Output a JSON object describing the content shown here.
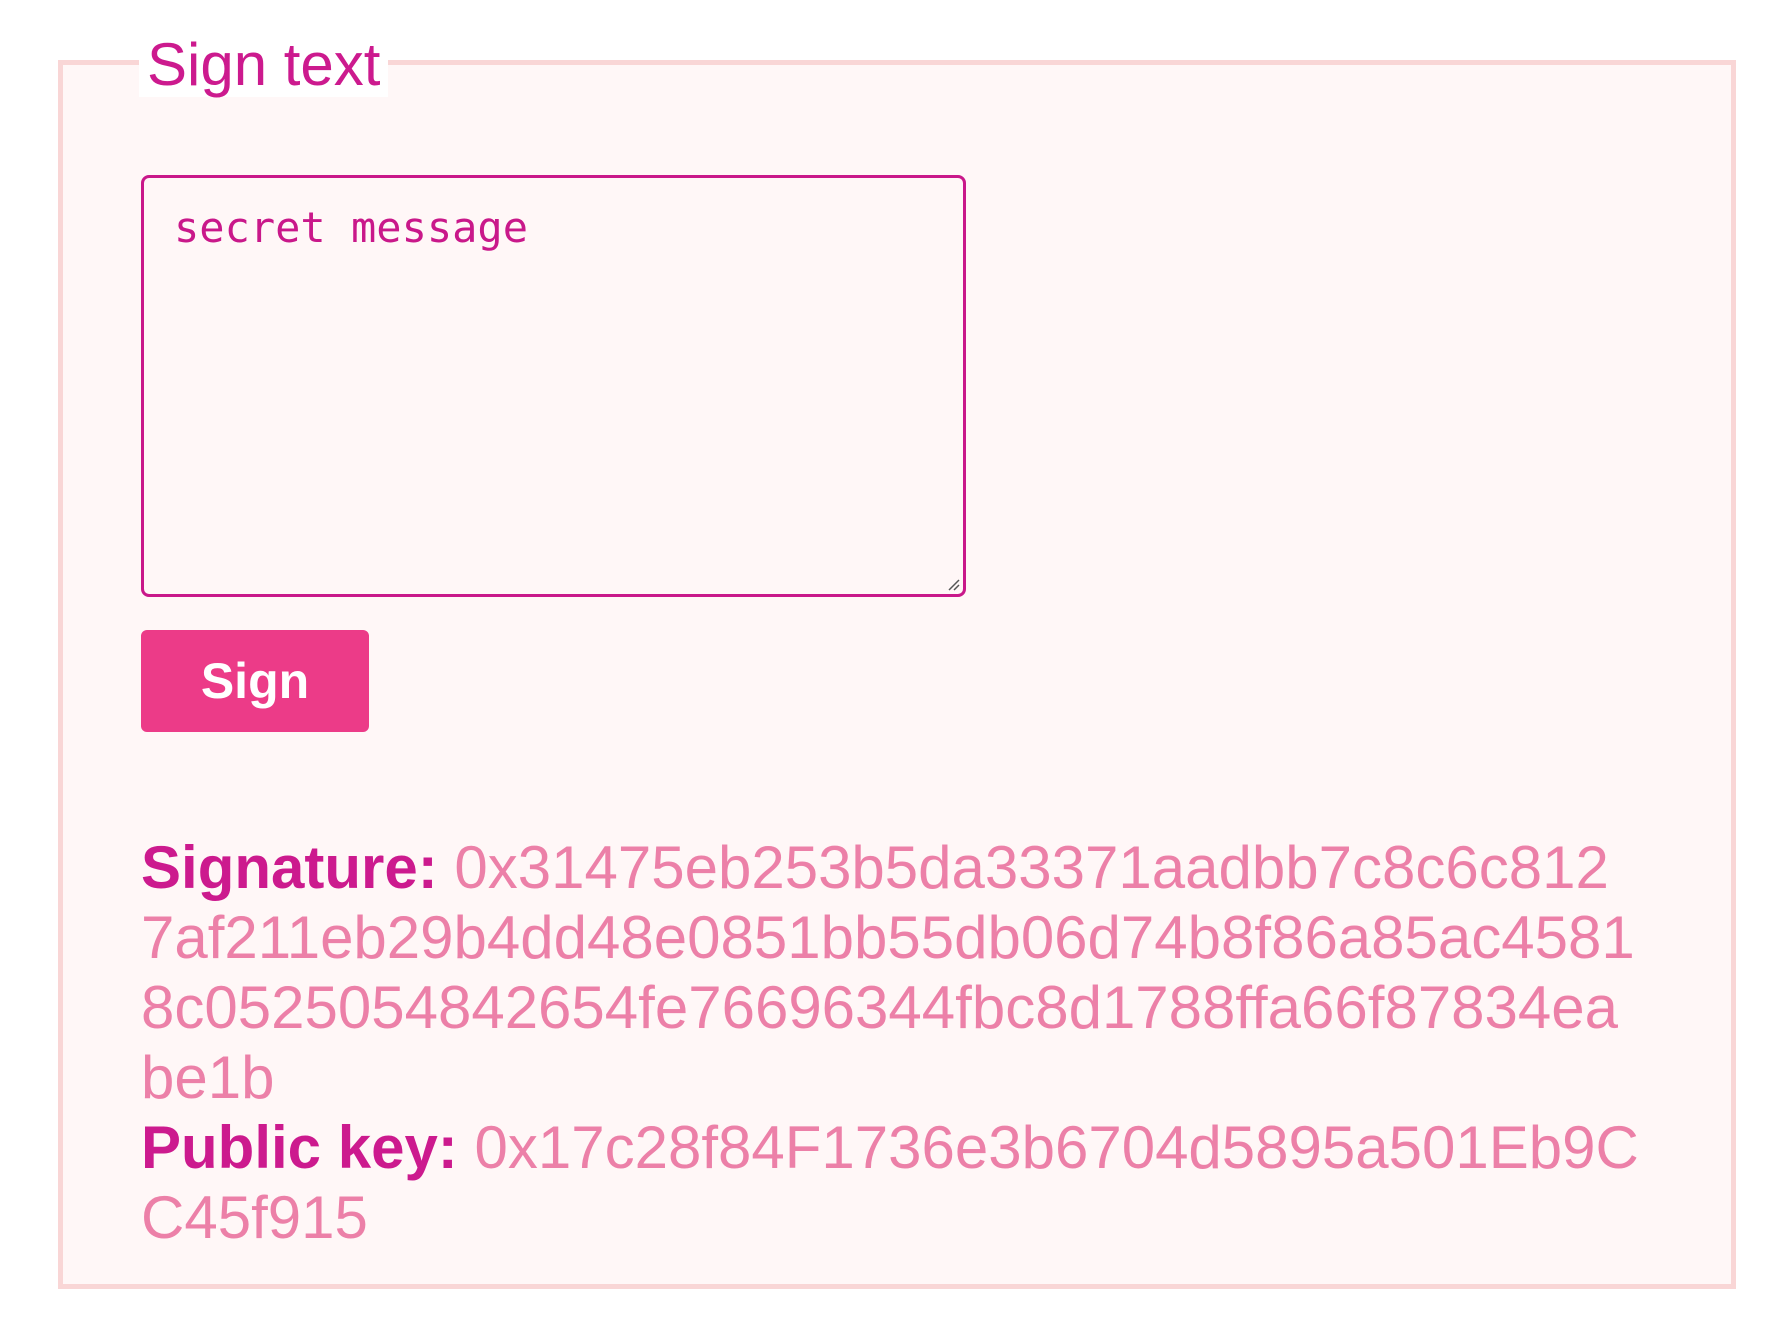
{
  "panel": {
    "legend": "Sign text"
  },
  "message": {
    "value": "secret message"
  },
  "sign_button": {
    "label": "Sign"
  },
  "result": {
    "signature_label": "Signature:",
    "signature_value": "0x31475eb253b5da33371aadbb7c8c6c8127af211eb29b4dd48e0851bb55db06d74b8f86a85ac45818c0525054842654fe76696344fbc8d1788ffa66f87834eabe1b",
    "public_key_label": "Public key:",
    "public_key_value": "0x17c28f84F1736e3b6704d5895a501Eb9CC45f915"
  },
  "colors": {
    "accent": "#cc1a8e",
    "button": "#ec3b88",
    "value_text": "#ec80a8",
    "border": "#f9d6d6",
    "panel_bg": "#fff7f7"
  }
}
